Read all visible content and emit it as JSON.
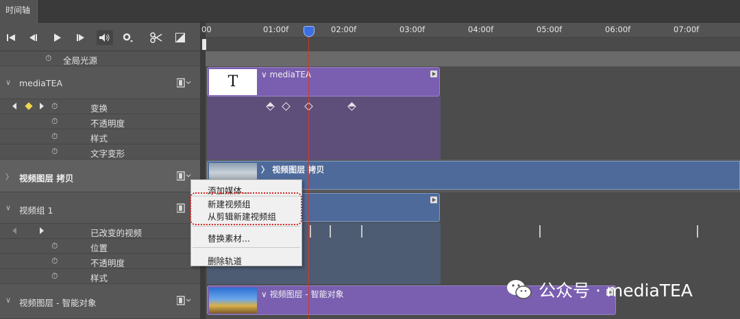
{
  "window": {
    "tab_label": "时间轴"
  },
  "controls": {
    "icons": [
      "go-to-first-frame-icon",
      "previous-frame-icon",
      "play-icon",
      "next-frame-icon",
      "audio-icon",
      "settings-icon",
      "split-clip-icon",
      "transition-icon"
    ]
  },
  "ruler": {
    "ticks": [
      "00",
      "01:00f",
      "02:00f",
      "03:00f",
      "04:00f",
      "05:00f",
      "06:00f",
      "07:00f"
    ]
  },
  "layers": {
    "global_light": "全局光源",
    "mediatea": {
      "name": "mediaTEA",
      "props": [
        "变换",
        "不透明度",
        "样式",
        "文字变形"
      ],
      "clip_name": "mediaTEA",
      "thumb_letter": "T"
    },
    "video_copy": {
      "name": "视频图层 拷贝",
      "clip_name": "视频图层 拷贝"
    },
    "video_group": {
      "name": "视频组 1",
      "props": [
        "已改变的视频",
        "位置",
        "不透明度",
        "样式"
      ]
    },
    "smart_video": {
      "name": "视频图层 - 智能对象",
      "clip_name": "视频图层 - 智能对象"
    }
  },
  "context_menu": {
    "items": [
      "添加媒体...",
      "新建视频组",
      "从剪辑新建视频组",
      "替换素材...",
      "删除轨道"
    ]
  },
  "watermark": {
    "text": "公众号 · mediaTEA"
  },
  "colors": {
    "panel_bg": "#535353",
    "purple_clip": "#7a5fb0",
    "blue_clip": "#4d6a9a",
    "playhead": "#d0392b",
    "highlight_border": "#d0231f"
  }
}
